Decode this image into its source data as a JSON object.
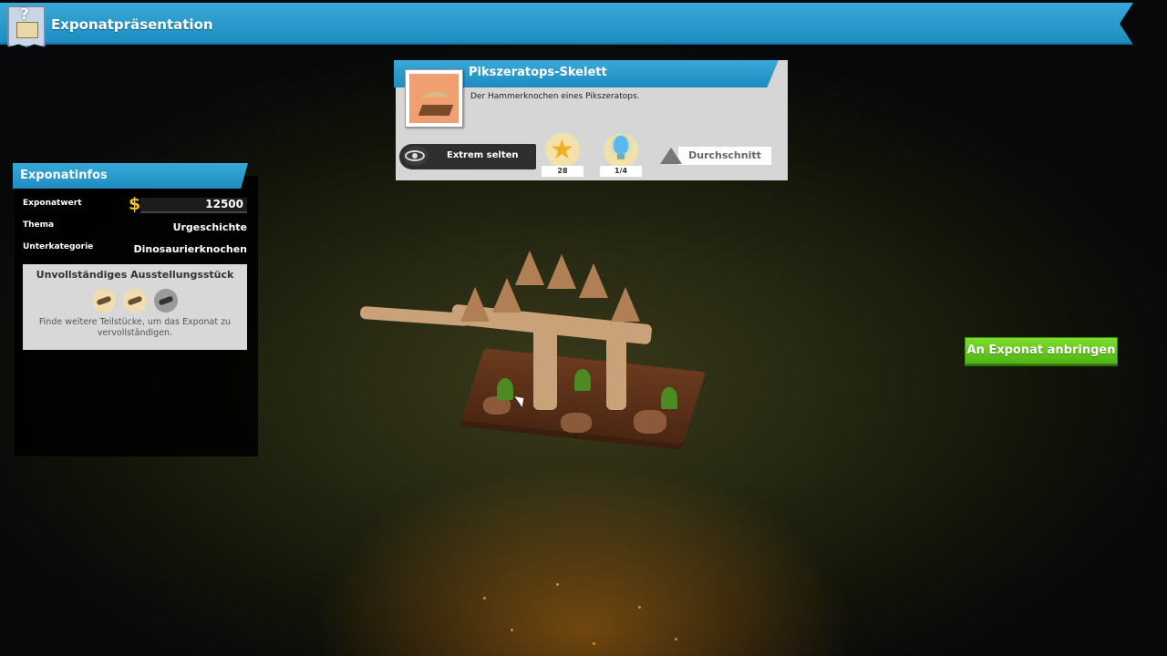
{
  "banner": {
    "title": "Exponatpräsentation",
    "icon": "question-box-icon"
  },
  "exhibit": {
    "title": "Pikszeratops-Skelett",
    "description": "Der Hammerknochen eines Pikszeratops.",
    "rarity": "Extrem selten",
    "stars": "28",
    "ideas": "1/4",
    "quality": "Durchschnitt"
  },
  "info": {
    "title": "Exponatinfos",
    "value_label": "Exponatwert",
    "value": "12500",
    "theme_label": "Thema",
    "theme": "Urgeschichte",
    "subcategory_label": "Unterkategorie",
    "subcategory": "Dinosaurierknochen",
    "incomplete": {
      "title": "Unvollständiges Ausstellungsstück",
      "hint": "Finde weitere Teilstücke, um das Exponat zu vervollständigen.",
      "pieces_found": 2,
      "pieces_total": 3
    }
  },
  "actions": {
    "attach": "An Exponat anbringen"
  },
  "colors": {
    "banner": "#2a9bd0",
    "button": "#62c41e",
    "panel": "#000000"
  }
}
